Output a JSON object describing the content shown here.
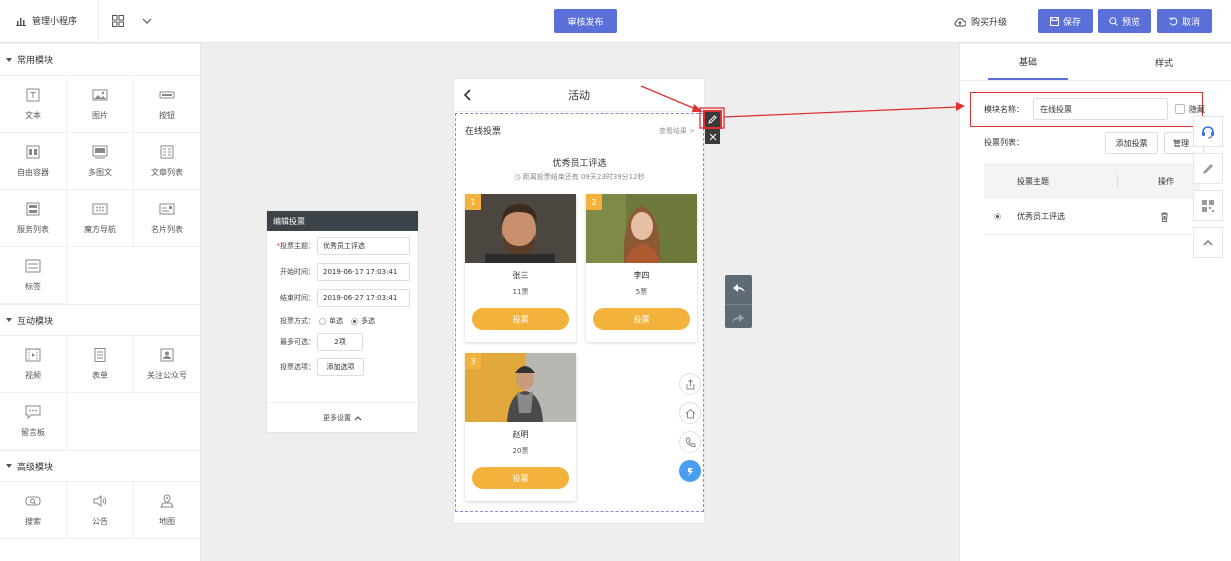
{
  "topbar": {
    "app_name": "管理小程序",
    "publish": "审核发布",
    "upgrade": "购买升级",
    "save": "保存",
    "preview": "预览",
    "cancel": "取消"
  },
  "sidebar": {
    "sections": [
      {
        "title": "常用模块",
        "items": [
          {
            "label": "文本",
            "icon": "text-icon"
          },
          {
            "label": "图片",
            "icon": "image-icon"
          },
          {
            "label": "按钮",
            "icon": "button-icon"
          },
          {
            "label": "自由容器",
            "icon": "container-icon"
          },
          {
            "label": "多图文",
            "icon": "multi-image-text-icon"
          },
          {
            "label": "文章列表",
            "icon": "article-list-icon"
          },
          {
            "label": "服务列表",
            "icon": "service-list-icon"
          },
          {
            "label": "魔方导航",
            "icon": "cube-nav-icon"
          },
          {
            "label": "名片列表",
            "icon": "card-list-icon"
          },
          {
            "label": "标签",
            "icon": "tag-icon"
          }
        ]
      },
      {
        "title": "互动模块",
        "items": [
          {
            "label": "视频",
            "icon": "video-icon"
          },
          {
            "label": "表单",
            "icon": "form-icon"
          },
          {
            "label": "关注公众号",
            "icon": "follow-account-icon"
          },
          {
            "label": "留言板",
            "icon": "message-board-icon"
          }
        ]
      },
      {
        "title": "高级模块",
        "items": [
          {
            "label": "搜索",
            "icon": "search-icon"
          },
          {
            "label": "公告",
            "icon": "announcement-icon"
          },
          {
            "label": "地图",
            "icon": "map-icon"
          }
        ]
      }
    ]
  },
  "phone": {
    "title": "活动",
    "module_title": "在线投票",
    "view_results": "查看结果",
    "vote_title": "优秀员工评选",
    "countdown": "距离投票结束还有 09天23时39分12秒",
    "vote_button": "投票",
    "candidates": [
      {
        "num": "1",
        "name": "张三",
        "votes": "11票"
      },
      {
        "num": "2",
        "name": "李四",
        "votes": "5票"
      },
      {
        "num": "3",
        "name": "赵明",
        "votes": "20票"
      }
    ]
  },
  "popup": {
    "title": "编辑投票",
    "topic_label": "投票主题：",
    "topic_value": "优秀员工评选",
    "start_label": "开始时间：",
    "start_value": "2019-06-17 17:03:41",
    "end_label": "结束时间：",
    "end_value": "2019-06-27 17:03:41",
    "mode_label": "投票方式：",
    "mode_single": "单选",
    "mode_multi": "多选",
    "max_label": "最多可选：",
    "max_value": "2项",
    "options_label": "投票选项：",
    "add_option": "添加选项",
    "more_settings": "更多设置"
  },
  "rpanel": {
    "tab_basic": "基础",
    "tab_style": "样式",
    "module_name_label": "模块名称：",
    "module_name_value": "在线投票",
    "hide_label": "隐藏",
    "vote_list_label": "投票列表：",
    "add_vote": "添加投票",
    "manage": "管理",
    "col_topic": "投票主题",
    "col_action": "操作",
    "row_topic": "优秀员工评选"
  },
  "colors": {
    "primary": "#5b6fd9",
    "vote_orange": "#f3b23b",
    "highlight_red": "#e03030"
  }
}
